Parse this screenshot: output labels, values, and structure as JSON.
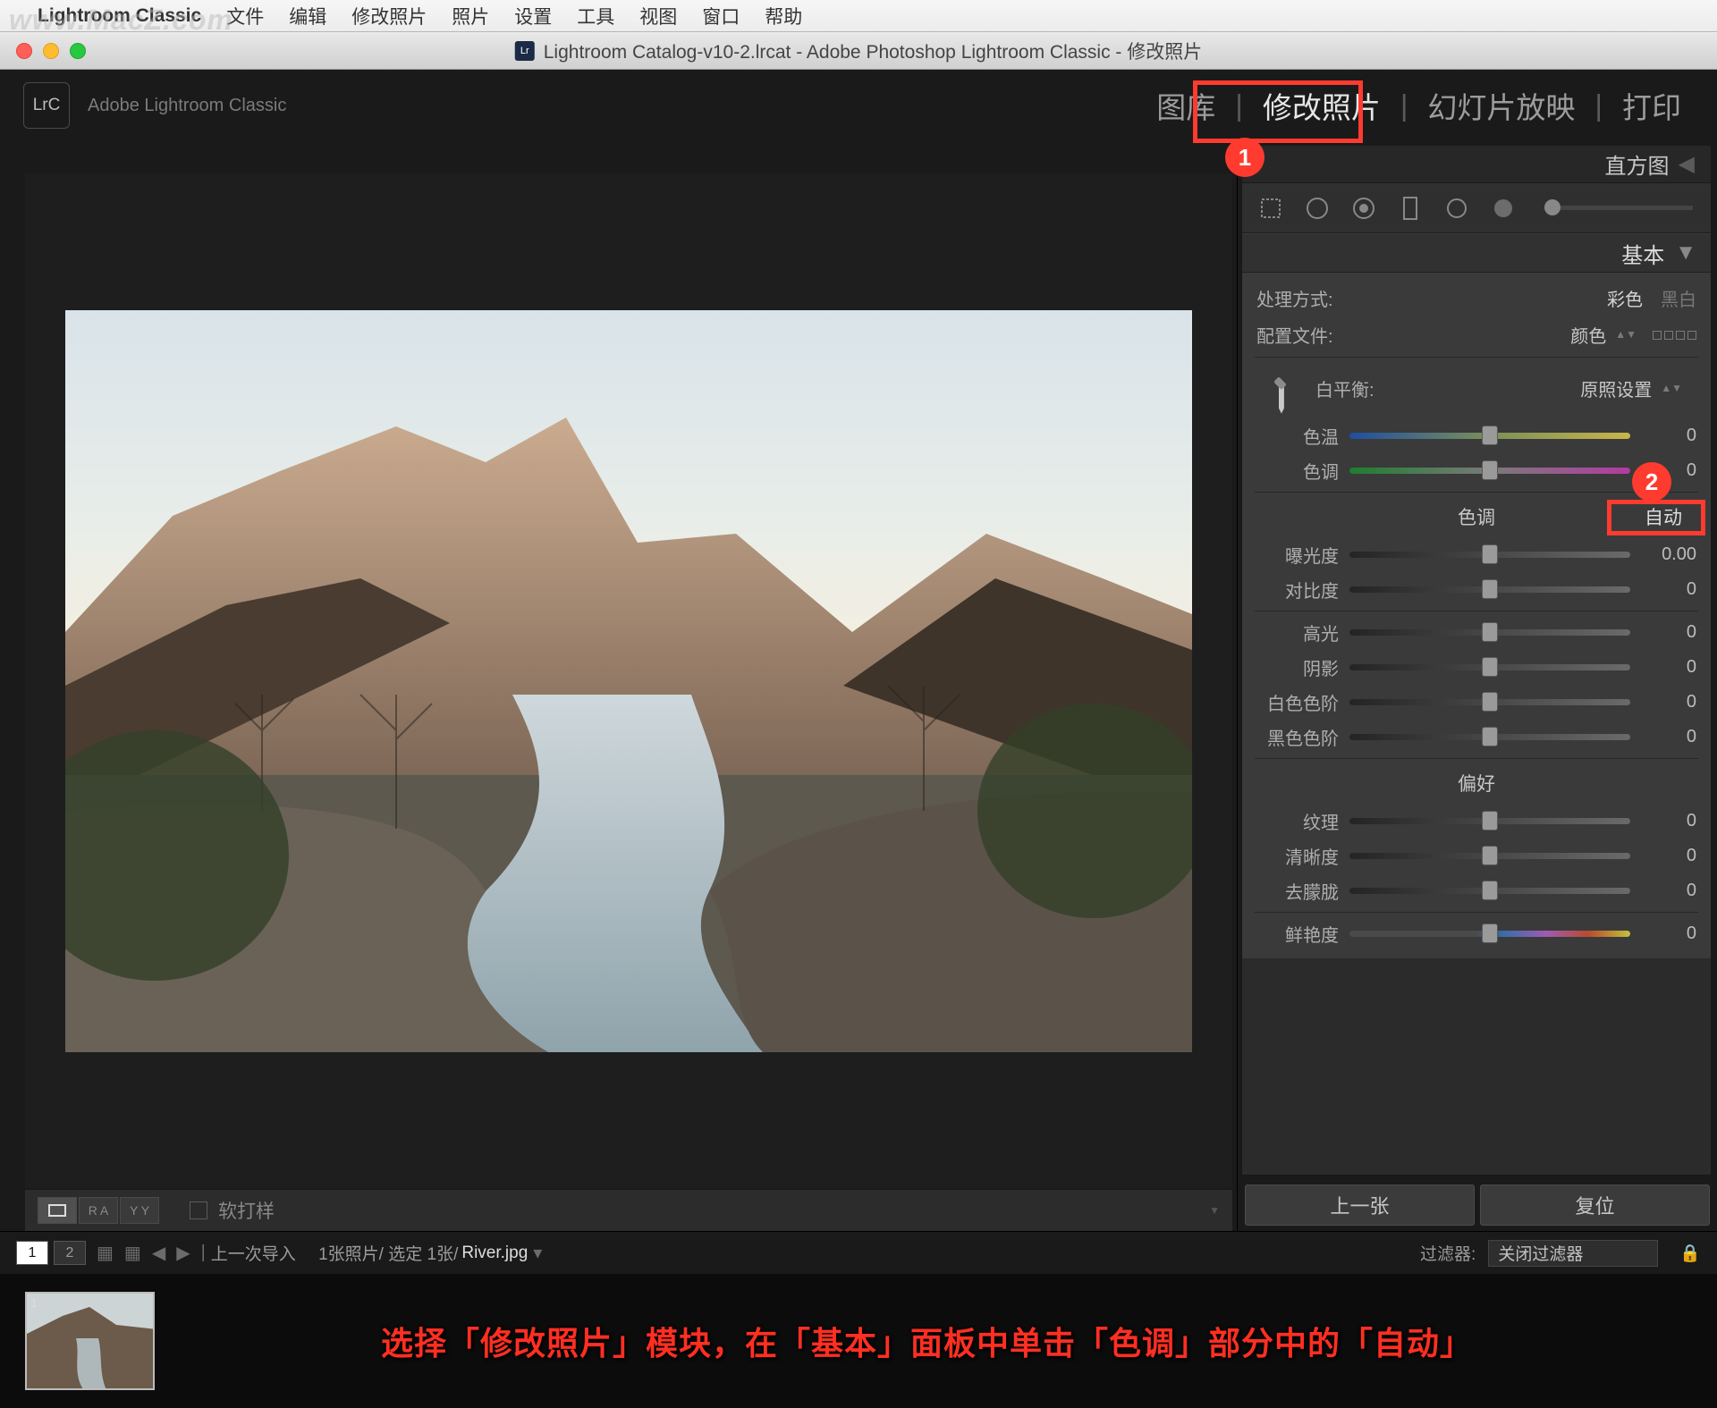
{
  "watermark": "www.MacZ.com",
  "menubar": {
    "app": "Lightroom Classic",
    "items": [
      "文件",
      "编辑",
      "修改照片",
      "照片",
      "设置",
      "工具",
      "视图",
      "窗口",
      "帮助"
    ]
  },
  "titlebar": {
    "title": "Lightroom Catalog-v10-2.lrcat - Adobe Photoshop Lightroom Classic - 修改照片"
  },
  "header": {
    "appName": "Adobe Lightroom Classic",
    "logo": "LrC",
    "modules": [
      "图库",
      "修改照片",
      "幻灯片放映",
      "打印"
    ],
    "active": 1
  },
  "rightHeader": {
    "histogram": "直方图"
  },
  "basicPanel": {
    "title": "基本",
    "treatmentLabel": "处理方式:",
    "treatmentColor": "彩色",
    "treatmentBW": "黑白",
    "profileLabel": "配置文件:",
    "profileValue": "颜色",
    "wbLabel": "白平衡:",
    "wbValue": "原照设置",
    "tempLabel": "色温",
    "tempValue": "0",
    "tintLabel": "色调",
    "tintValue": "0",
    "toneHeader": "色调",
    "autoLabel": "自动",
    "tone": [
      {
        "label": "曝光度",
        "value": "0.00"
      },
      {
        "label": "对比度",
        "value": "0"
      },
      {
        "label": "高光",
        "value": "0"
      },
      {
        "label": "阴影",
        "value": "0"
      },
      {
        "label": "白色色阶",
        "value": "0"
      },
      {
        "label": "黑色色阶",
        "value": "0"
      }
    ],
    "presenceHeader": "偏好",
    "presence": [
      {
        "label": "纹理",
        "value": "0"
      },
      {
        "label": "清晰度",
        "value": "0"
      },
      {
        "label": "去朦胧",
        "value": "0"
      }
    ],
    "vibranceLabel": "鲜艳度",
    "vibranceValue": "0"
  },
  "navButtons": {
    "prev": "上一张",
    "reset": "复位"
  },
  "bottomToolbar": {
    "views": [
      "□",
      "R A",
      "Y Y"
    ],
    "softProofLabel": "软打样"
  },
  "strip": {
    "pages": [
      "1",
      "2"
    ],
    "breadcrumb_a": "上一次导入",
    "breadcrumb_b": "1张照片/ 选定 1张/",
    "breadcrumb_file": "River.jpg",
    "filterLabel": "过滤器:",
    "filterValue": "关闭过滤器"
  },
  "filmstrip": {
    "thumbIndex": "1"
  },
  "caption": "选择「修改照片」模块，在「基本」面板中单击「色调」部分中的「自动」",
  "annotations": {
    "badge1": "1",
    "badge2": "2"
  }
}
